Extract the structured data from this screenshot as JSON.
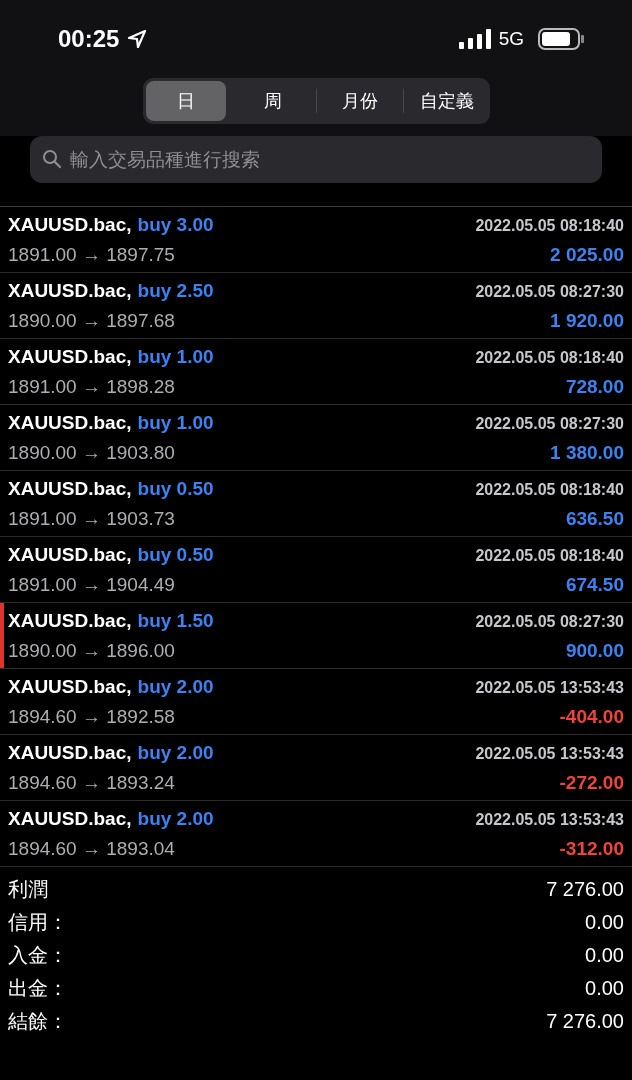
{
  "status_bar": {
    "time": "00:25",
    "network": "5G"
  },
  "tabs": [
    {
      "label": "日",
      "selected": true
    },
    {
      "label": "周",
      "selected": false
    },
    {
      "label": "月份",
      "selected": false
    },
    {
      "label": "自定義",
      "selected": false
    }
  ],
  "search": {
    "placeholder": "輸入交易品種進行搜索"
  },
  "trades": [
    {
      "symbol": "XAUUSD.bac,",
      "order": "buy 3.00",
      "time": "2022.05.05 08:18:40",
      "prices": "1891.00 → 1897.75",
      "profit": "2 025.00",
      "negative": false,
      "selected": false
    },
    {
      "symbol": "XAUUSD.bac,",
      "order": "buy 2.50",
      "time": "2022.05.05 08:27:30",
      "prices": "1890.00 → 1897.68",
      "profit": "1 920.00",
      "negative": false,
      "selected": false
    },
    {
      "symbol": "XAUUSD.bac,",
      "order": "buy 1.00",
      "time": "2022.05.05 08:18:40",
      "prices": "1891.00 → 1898.28",
      "profit": "728.00",
      "negative": false,
      "selected": false
    },
    {
      "symbol": "XAUUSD.bac,",
      "order": "buy 1.00",
      "time": "2022.05.05 08:27:30",
      "prices": "1890.00 → 1903.80",
      "profit": "1 380.00",
      "negative": false,
      "selected": false
    },
    {
      "symbol": "XAUUSD.bac,",
      "order": "buy 0.50",
      "time": "2022.05.05 08:18:40",
      "prices": "1891.00 → 1903.73",
      "profit": "636.50",
      "negative": false,
      "selected": false
    },
    {
      "symbol": "XAUUSD.bac,",
      "order": "buy 0.50",
      "time": "2022.05.05 08:18:40",
      "prices": "1891.00 → 1904.49",
      "profit": "674.50",
      "negative": false,
      "selected": false
    },
    {
      "symbol": "XAUUSD.bac,",
      "order": "buy 1.50",
      "time": "2022.05.05 08:27:30",
      "prices": "1890.00 → 1896.00",
      "profit": "900.00",
      "negative": false,
      "selected": true
    },
    {
      "symbol": "XAUUSD.bac,",
      "order": "buy 2.00",
      "time": "2022.05.05 13:53:43",
      "prices": "1894.60 → 1892.58",
      "profit": "-404.00",
      "negative": true,
      "selected": false
    },
    {
      "symbol": "XAUUSD.bac,",
      "order": "buy 2.00",
      "time": "2022.05.05 13:53:43",
      "prices": "1894.60 → 1893.24",
      "profit": "-272.00",
      "negative": true,
      "selected": false
    },
    {
      "symbol": "XAUUSD.bac,",
      "order": "buy 2.00",
      "time": "2022.05.05 13:53:43",
      "prices": "1894.60 → 1893.04",
      "profit": "-312.00",
      "negative": true,
      "selected": false
    }
  ],
  "summary": [
    {
      "label": "利潤",
      "value": "7 276.00"
    },
    {
      "label": "信用：",
      "value": "0.00"
    },
    {
      "label": "入金：",
      "value": "0.00"
    },
    {
      "label": "出金：",
      "value": "0.00"
    },
    {
      "label": "結餘：",
      "value": "7 276.00"
    }
  ]
}
